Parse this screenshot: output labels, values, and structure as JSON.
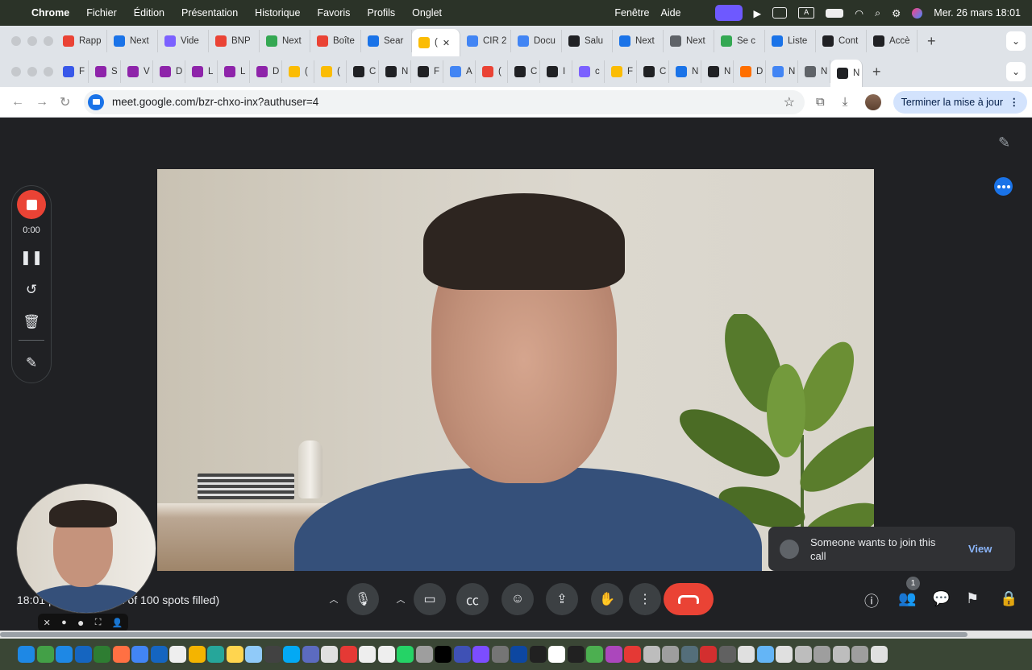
{
  "menubar": {
    "app": "Chrome",
    "items": [
      "Fichier",
      "Édition",
      "Présentation",
      "Historique",
      "Favoris",
      "Profils",
      "Onglet"
    ],
    "right_items": [
      "Fenêtre",
      "Aide"
    ],
    "clock": "Mer. 26 mars  18:01"
  },
  "tabs_row1": [
    {
      "label": "Rapp",
      "color": "#ea4335"
    },
    {
      "label": "Next",
      "color": "#1a73e8"
    },
    {
      "label": "Vide",
      "color": "#7b61ff"
    },
    {
      "label": "BNP",
      "color": "#ea4335"
    },
    {
      "label": "Next",
      "color": "#34a853"
    },
    {
      "label": "Boîte",
      "color": "#ea4335"
    },
    {
      "label": "Sear",
      "color": "#1a73e8"
    },
    {
      "label": "(",
      "color": "#fbbc04",
      "active": true
    },
    {
      "label": "CIR 2",
      "color": "#4285f4"
    },
    {
      "label": "Docu",
      "color": "#4285f4"
    },
    {
      "label": "Salu",
      "color": "#202124"
    },
    {
      "label": "Next",
      "color": "#1a73e8"
    },
    {
      "label": "Next",
      "color": "#5f6368"
    },
    {
      "label": "Se c",
      "color": "#34a853"
    },
    {
      "label": "Liste",
      "color": "#1a73e8"
    },
    {
      "label": "Cont",
      "color": "#202124"
    },
    {
      "label": "Accè",
      "color": "#202124"
    }
  ],
  "tabs_row2": [
    {
      "label": "F",
      "color": "#3858e9"
    },
    {
      "label": "S",
      "color": "#8e24aa"
    },
    {
      "label": "V",
      "color": "#8e24aa"
    },
    {
      "label": "D",
      "color": "#8e24aa"
    },
    {
      "label": "L",
      "color": "#8e24aa"
    },
    {
      "label": "L",
      "color": "#8e24aa"
    },
    {
      "label": "D",
      "color": "#8e24aa"
    },
    {
      "label": "(",
      "color": "#fbbc04"
    },
    {
      "label": "(",
      "color": "#fbbc04"
    },
    {
      "label": "C",
      "color": "#202124"
    },
    {
      "label": "N",
      "color": "#202124"
    },
    {
      "label": "F",
      "color": "#202124"
    },
    {
      "label": "A",
      "color": "#4285f4"
    },
    {
      "label": "(",
      "color": "#ea4335"
    },
    {
      "label": "C",
      "color": "#202124"
    },
    {
      "label": "I",
      "color": "#202124"
    },
    {
      "label": "c",
      "color": "#7b61ff"
    },
    {
      "label": "F",
      "color": "#fbbc04"
    },
    {
      "label": "C",
      "color": "#202124"
    },
    {
      "label": "N",
      "color": "#1a73e8"
    },
    {
      "label": "N",
      "color": "#202124"
    },
    {
      "label": "D",
      "color": "#ff6f00"
    },
    {
      "label": "N",
      "color": "#4285f4"
    },
    {
      "label": "N",
      "color": "#5f6368"
    },
    {
      "label": "N",
      "color": "#202124",
      "active": true
    }
  ],
  "omnibar": {
    "url": "meet.google.com/bzr-chxo-inx?authuser=4",
    "update_label": "Terminer la mise à jour"
  },
  "recorder": {
    "time": "0:00"
  },
  "notification": {
    "text": "Someone wants to join this call",
    "action": "View"
  },
  "controls": {
    "meeting_info": "18:01 | Nextmotion (1 of 100 spots filled)",
    "participants_count": "1"
  },
  "dock_colors": [
    "#1e88e5",
    "#43a047",
    "#1e88e5",
    "#1565c0",
    "#2e7d32",
    "#ff7043",
    "#4285f4",
    "#1565c0",
    "#eeeeee",
    "#f4b400",
    "#26a69a",
    "#ffd54f",
    "#90caf9",
    "#424242",
    "#03a9f4",
    "#5c6bc0",
    "#e0e0e0",
    "#e53935",
    "#eeeeee",
    "#eeeeee",
    "#25d366",
    "#9e9e9e",
    "#000000",
    "#3f51b5",
    "#7c4dff",
    "#757575",
    "#0d47a1",
    "#212121",
    "#ffffff",
    "#212121",
    "#4caf50",
    "#ab47bc",
    "#e53935",
    "#bdbdbd",
    "#9e9e9e",
    "#546e7a",
    "#d32f2f",
    "#616161",
    "#e0e0e0",
    "#64b5f6",
    "#e0e0e0",
    "#bdbdbd",
    "#9e9e9e",
    "#bdbdbd",
    "#9e9e9e",
    "#e0e0e0"
  ]
}
